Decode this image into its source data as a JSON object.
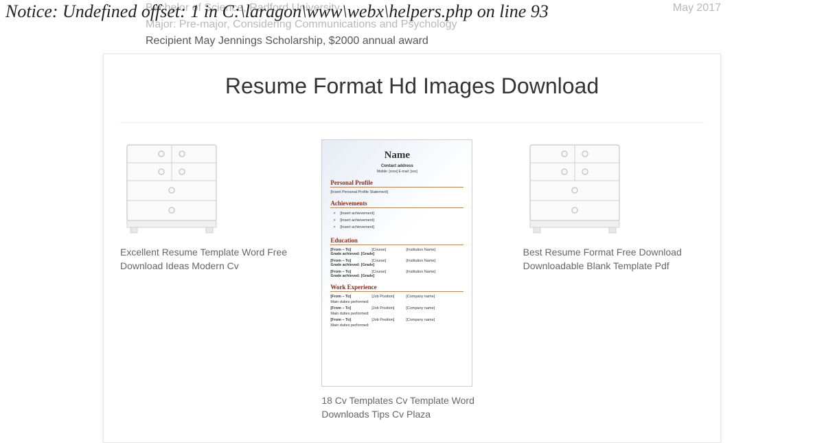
{
  "notice": "Notice: Undefined offset: 1 in C:\\laragon\\www\\webx\\helpers.php on line 93",
  "bg": {
    "degree": "Bachelor of Science, Radford University",
    "date": "May 2017",
    "major": "Major: Pre-major, Considering Communications and Psychology",
    "recipient": "Recipient May Jennings Scholarship, $2000 annual award"
  },
  "title": "Resume Format Hd Images Download",
  "items": [
    {
      "caption": "Excellent Resume Template Word Free Download Ideas Modern Cv"
    },
    {
      "caption": "18 Cv Templates Cv Template Word Downloads Tips Cv Plaza"
    },
    {
      "caption": "Best Resume Format Free Download Downloadable Blank Template Pdf"
    }
  ],
  "cv": {
    "name": "Name",
    "contact": "Contact address",
    "contact2": "Mobile: [xxxx]   E-mail: [xxx]",
    "s1": "Personal Profile",
    "s1t": "[Insert Personal Profile Statement]",
    "s2": "Achievements",
    "a1": "[Insert achievement]",
    "a2": "[Insert achievement]",
    "a3": "[Insert achievement]",
    "s3": "Education",
    "ft": "[From – To]",
    "course": "[Course]",
    "grade_lbl": "Grade achieved:",
    "grade": "[Grade]",
    "inst": "[Institution Name]",
    "s4": "Work Experience",
    "job": "[Job Position]",
    "comp": "[Company name]",
    "duties": "Main duties performed:"
  }
}
